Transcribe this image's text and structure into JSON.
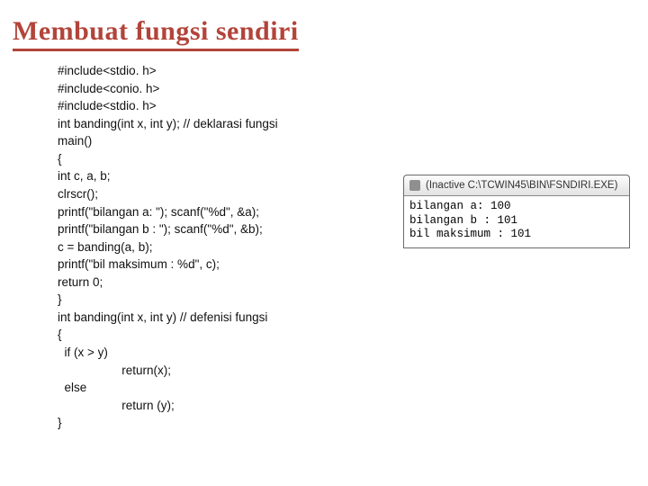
{
  "title": "Membuat fungsi sendiri",
  "code": "#include<stdio. h>\n#include<conio. h>\n#include<stdio. h>\nint banding(int x, int y); // deklarasi fungsi\nmain()\n{\nint c, a, b;\nclrscr();\nprintf(\"bilangan a: \"); scanf(\"%d\", &a);\nprintf(\"bilangan b : \"); scanf(\"%d\", &b);\nc = banding(a, b);\nprintf(\"bil maksimum : %d\", c);\nreturn 0;\n}\nint banding(int x, int y) // defenisi fungsi\n{\n  if (x > y)\n                   return(x);\n  else\n                   return (y);\n}",
  "console": {
    "title": "(Inactive C:\\TCWIN45\\BIN\\FSNDIRI.EXE)",
    "output": "bilangan a: 100\nbilangan b : 101\nbil maksimum : 101"
  }
}
